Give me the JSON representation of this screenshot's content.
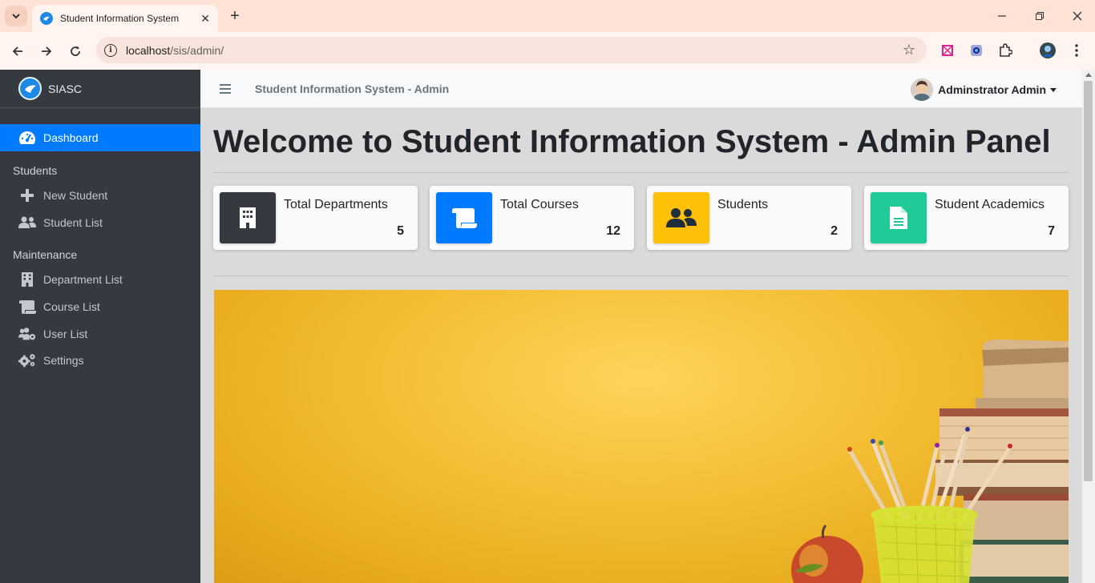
{
  "browser": {
    "tab_title": "Student Information System",
    "url_host": "localhost",
    "url_path": "/sis/admin/"
  },
  "sidebar": {
    "brand": "SIASC",
    "items": [
      {
        "label": "Dashboard",
        "icon": "tachometer-icon",
        "active": true
      },
      {
        "header": "Students"
      },
      {
        "label": "New Student",
        "icon": "plus-icon"
      },
      {
        "label": "Student List",
        "icon": "users-icon"
      },
      {
        "header": "Maintenance"
      },
      {
        "label": "Department List",
        "icon": "building-icon"
      },
      {
        "label": "Course List",
        "icon": "scroll-icon"
      },
      {
        "label": "User List",
        "icon": "users-cog-icon"
      },
      {
        "label": "Settings",
        "icon": "cogs-icon"
      }
    ]
  },
  "topnav": {
    "title": "Student Information System - Admin",
    "user_name": "Adminstrator Admin"
  },
  "main": {
    "heading": "Welcome to Student Information System - Admin Panel",
    "cards": [
      {
        "label": "Total Departments",
        "value": "5",
        "icon": "building-icon",
        "color": "#343a40"
      },
      {
        "label": "Total Courses",
        "value": "12",
        "icon": "scroll-icon",
        "color": "#007bff"
      },
      {
        "label": "Students",
        "value": "2",
        "icon": "users-icon",
        "color": "#ffc107"
      },
      {
        "label": "Student Academics",
        "value": "7",
        "icon": "file-icon",
        "color": "#20c997"
      }
    ]
  },
  "colors": {
    "sidebar_bg": "#343a40",
    "active_nav": "#007bff",
    "banner_yellow": "#f6c23a"
  }
}
